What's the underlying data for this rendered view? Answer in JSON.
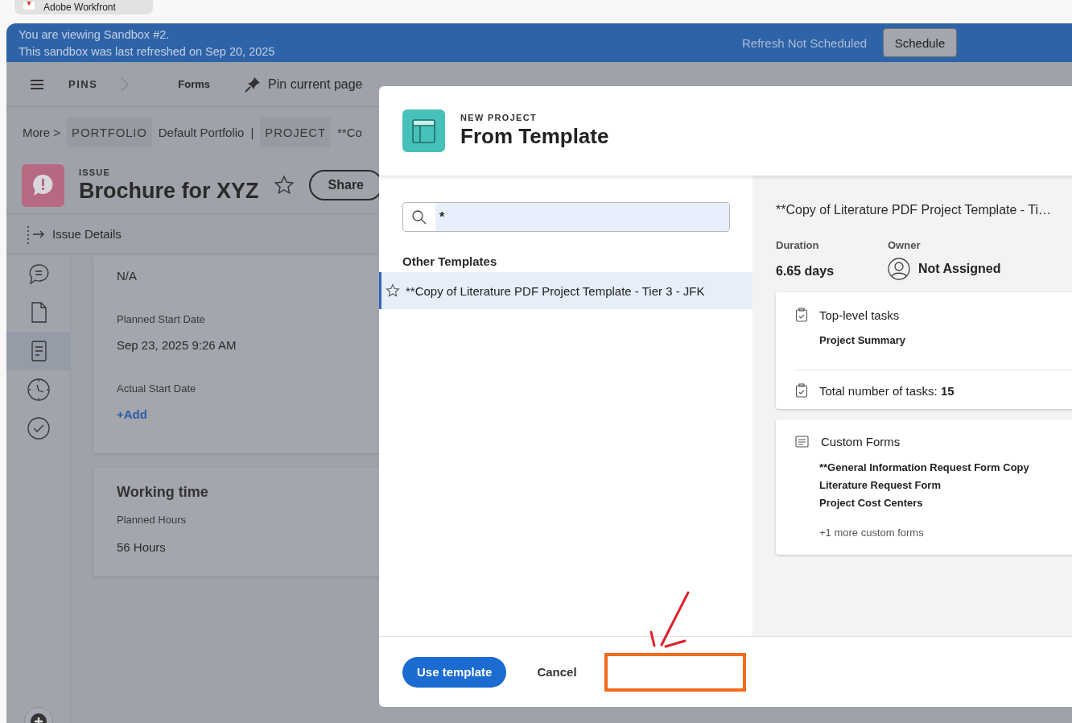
{
  "browser_tab": {
    "title": "Adobe Workfront"
  },
  "sandbox_banner": {
    "line_1": "You are viewing Sandbox #2.",
    "line_2": "This sandbox was last refreshed on Sep 20, 2025",
    "refresh_status": "Refresh Not Scheduled",
    "button": "Schedule"
  },
  "nav": {
    "pins": "PINS",
    "items": [
      "Forms"
    ],
    "pin_page": "Pin current page"
  },
  "breadcrumb": [
    {
      "label": "More >",
      "kind": "link"
    },
    {
      "label": "PORTFOLIO",
      "kind": "tag"
    },
    {
      "label": "Default Portfolio",
      "kind": "link"
    },
    {
      "label": "|",
      "kind": "separator"
    },
    {
      "label": "PROJECT",
      "kind": "tag"
    },
    {
      "label": "**Co",
      "kind": "link"
    }
  ],
  "header": {
    "type": "ISSUE",
    "title": "Brochure for XYZ",
    "favorite": false,
    "share": "Share"
  },
  "section_tab": "Issue Details",
  "rail": [
    {
      "kind": "comment",
      "selected": false
    },
    {
      "kind": "document",
      "selected": false
    },
    {
      "kind": "form",
      "selected": true
    },
    {
      "kind": "clock",
      "selected": false
    },
    {
      "kind": "check",
      "selected": false
    }
  ],
  "details_card": {
    "fields": [
      {
        "value": "N/A"
      },
      {
        "label": "Planned Start Date",
        "value": "Sep 23, 2025 9:26 AM"
      },
      {
        "label": "Actual Start Date",
        "value": "+Add",
        "kind": "link"
      }
    ]
  },
  "working_time": {
    "title": "Working time",
    "fields": [
      {
        "label": "Planned Hours",
        "value": "56 Hours"
      }
    ]
  },
  "dialog": {
    "eyebrow": "NEW PROJECT",
    "title": "From Template",
    "search": {
      "value": "*"
    },
    "list_heading": "Other Templates",
    "templates": [
      {
        "name": "**Copy of Literature PDF Project Template - Tier 3 - JFK",
        "selected": true,
        "favorite": false
      }
    ],
    "preview": {
      "title": "**Copy of Literature PDF Project Template - Ti…",
      "duration_label": "Duration",
      "duration": "6.65 days",
      "owner_label": "Owner",
      "owner": "Not Assigned",
      "tasks_heading": "Top-level tasks",
      "tasks": [
        "Project Summary"
      ],
      "total_tasks": "Total number of tasks: **15**",
      "forms_heading": "Custom Forms",
      "forms": [
        "**General Information Request Form Copy",
        "Literature Request Form",
        "Project Cost Centers"
      ],
      "more_forms": "+1 more custom forms"
    },
    "primary_button": "Use template",
    "cancel_button": "Cancel"
  }
}
